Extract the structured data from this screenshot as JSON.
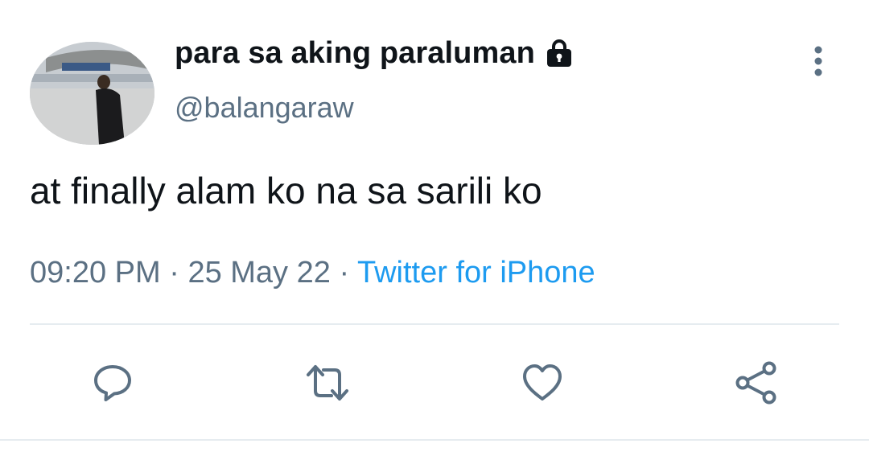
{
  "tweet": {
    "display_name": "para sa aking paraluman",
    "handle": "@balangaraw",
    "text": "at finally alam ko na sa sarili ko",
    "time": "09:20 PM",
    "date": "25 May 22",
    "separator": " · ",
    "source": "Twitter for iPhone"
  },
  "icons": {
    "lock": "lock-icon",
    "more": "more-vertical-icon",
    "reply": "reply-icon",
    "retweet": "retweet-icon",
    "like": "heart-icon",
    "share": "share-icon"
  },
  "colors": {
    "text": "#0f1419",
    "secondary": "#5b7083",
    "link": "#1d9bf0",
    "divider": "#e6ecf0"
  }
}
